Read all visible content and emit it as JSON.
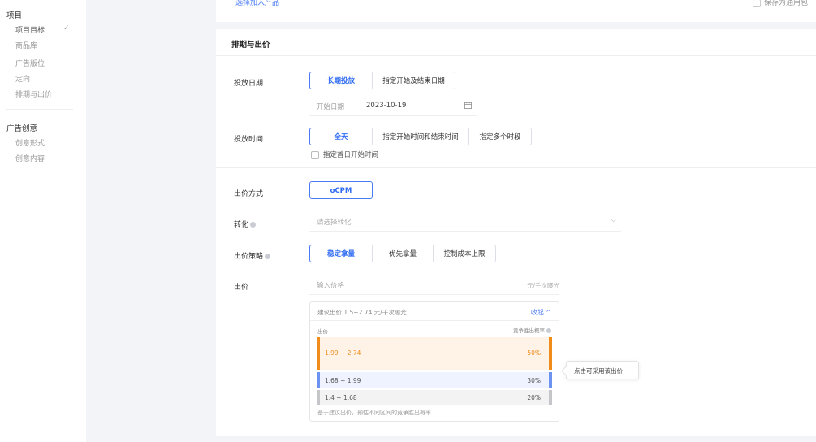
{
  "sidebar": {
    "section1_title": "项目",
    "items1": [
      "项目目标",
      "商品库",
      "广告版位",
      "定向",
      "排期与出价"
    ],
    "check_icon": "✓",
    "section2_title": "广告创意",
    "items2": [
      "创意形式",
      "创意内容"
    ]
  },
  "top_card": {
    "link": "选择加入产品",
    "right_text": "保存为通用包"
  },
  "schedule": {
    "title": "排期与出价",
    "date_label": "投放日期",
    "date_options": [
      "长期投放",
      "指定开始及结束日期"
    ],
    "start_label": "开始日期",
    "start_value": "2023-10-19",
    "time_label": "投放时间",
    "time_options": [
      "全天",
      "指定开始时间和结束时间",
      "指定多个时段"
    ],
    "first_day_checkbox": "指定首日开始时间"
  },
  "bidding": {
    "method_label": "出价方式",
    "method_value": "oCPM",
    "convert_label": "转化",
    "convert_placeholder": "请选择转化",
    "strategy_label": "出价策略",
    "strategy_options": [
      "稳定拿量",
      "优先拿量",
      "控制成本上限"
    ],
    "price_label": "出价",
    "price_placeholder": "输入价格",
    "price_unit": "元/千次曝光"
  },
  "suggest": {
    "text": "建议出价 1.5~2.74 元/千次曝光",
    "collapse": "收起 ^",
    "col_price": "出价",
    "col_rate": "竞争胜出概率",
    "rows": [
      {
        "range": "1.99 ~ 2.74",
        "pct": "50%"
      },
      {
        "range": "1.68 ~ 1.99",
        "pct": "30%"
      },
      {
        "range": "1.4 ~ 1.68",
        "pct": "20%"
      }
    ],
    "footer": "基于建议出价，预估不同区间的竞争胜出概率",
    "tooltip": "点击可采用该出价"
  },
  "colors": {
    "accent": "#2f6bf2",
    "high": "#f08c1a",
    "mid": "#6b93ef",
    "low": "#c4c6ca"
  }
}
